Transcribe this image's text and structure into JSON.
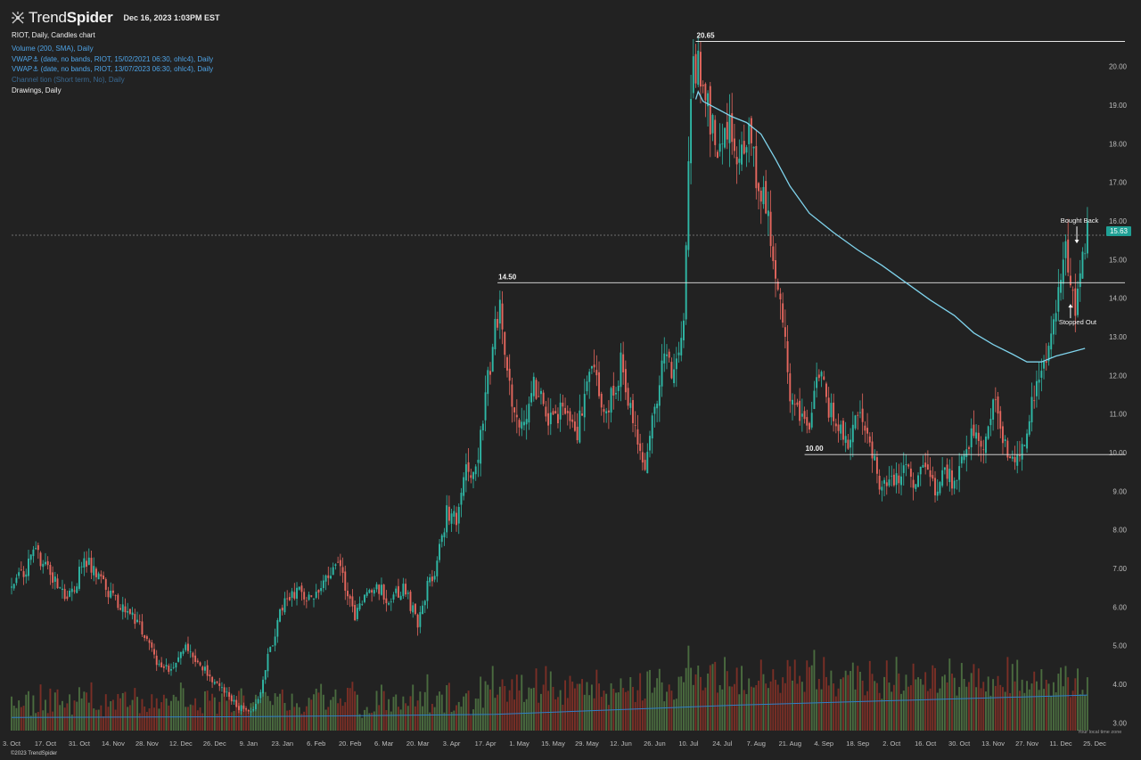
{
  "header": {
    "brand_light": "Trend",
    "brand_bold": "Spider",
    "datetime": "Dec 16, 2023 1:03PM EST"
  },
  "legend": {
    "title": "RIOT, Daily, Candles chart",
    "indicators": [
      "Volume (200, SMA), Daily",
      "VWAP⚓ (date, no bands, RIOT, 15/02/2021 06:30, ohlc4), Daily",
      "VWAP⚓ (date, no bands, RIOT, 13/07/2023 06:30, ohlc4), Daily",
      "Channel tion (Short term, No), Daily"
    ],
    "drawings": "Drawings, Daily"
  },
  "footer": {
    "copyright": "©2023 TrendSpider",
    "timezone": "Your local time zone"
  },
  "colors": {
    "background": "#222222",
    "up": "#2fb8a6",
    "down": "#e5675e",
    "vol_up": "#4a6b3f",
    "vol_down": "#7a2f26",
    "vwap": "#7fd3ec",
    "vol_sma": "#2f7fc8",
    "last_price_tag": "#1fa095"
  },
  "chart_data": {
    "type": "candlestick",
    "symbol": "RIOT",
    "timeframe": "Daily",
    "y_axis": {
      "range": [
        2.8,
        20.8
      ],
      "ticks": [
        "3.00",
        "4.00",
        "5.00",
        "6.00",
        "7.00",
        "8.00",
        "9.00",
        "10.00",
        "11.00",
        "12.00",
        "13.00",
        "14.00",
        "15.00",
        "16.00",
        "17.00",
        "18.00",
        "19.00",
        "20.00"
      ]
    },
    "x_axis": {
      "ticks": [
        "3. Oct",
        "17. Oct",
        "31. Oct",
        "14. Nov",
        "28. Nov",
        "12. Dec",
        "26. Dec",
        "9. Jan",
        "23. Jan",
        "6. Feb",
        "20. Feb",
        "6. Mar",
        "20. Mar",
        "3. Apr",
        "17. Apr",
        "1. May",
        "15. May",
        "29. May",
        "12. Jun",
        "26. Jun",
        "10. Jul",
        "24. Jul",
        "7. Aug",
        "21. Aug",
        "4. Sep",
        "18. Sep",
        "2. Oct",
        "16. Oct",
        "30. Oct",
        "13. Nov",
        "27. Nov",
        "11. Dec",
        "25. Dec"
      ],
      "range_days": [
        0,
        455
      ]
    },
    "last_price": "15.63",
    "close_path": [
      [
        0,
        6.5
      ],
      [
        10,
        7.4
      ],
      [
        16,
        6.9
      ],
      [
        22,
        6.2
      ],
      [
        26,
        6.5
      ],
      [
        30,
        7.3
      ],
      [
        34,
        7.0
      ],
      [
        42,
        6.2
      ],
      [
        52,
        5.6
      ],
      [
        60,
        4.6
      ],
      [
        66,
        4.4
      ],
      [
        72,
        4.9
      ],
      [
        78,
        4.5
      ],
      [
        86,
        3.9
      ],
      [
        94,
        3.4
      ],
      [
        98,
        3.3
      ],
      [
        102,
        3.6
      ],
      [
        106,
        4.7
      ],
      [
        112,
        6.0
      ],
      [
        118,
        6.4
      ],
      [
        124,
        6.3
      ],
      [
        130,
        6.7
      ],
      [
        134,
        7.3
      ],
      [
        138,
        6.6
      ],
      [
        142,
        5.8
      ],
      [
        146,
        6.3
      ],
      [
        150,
        6.6
      ],
      [
        156,
        6.2
      ],
      [
        162,
        6.5
      ],
      [
        168,
        5.6
      ],
      [
        172,
        6.5
      ],
      [
        176,
        7.1
      ],
      [
        180,
        8.5
      ],
      [
        184,
        8.3
      ],
      [
        188,
        9.6
      ],
      [
        192,
        9.4
      ],
      [
        196,
        11.5
      ],
      [
        200,
        13.2
      ],
      [
        202,
        13.6
      ],
      [
        206,
        11.8
      ],
      [
        210,
        10.5
      ],
      [
        216,
        11.8
      ],
      [
        222,
        10.8
      ],
      [
        228,
        11.2
      ],
      [
        234,
        10.6
      ],
      [
        240,
        12.2
      ],
      [
        246,
        10.9
      ],
      [
        252,
        12.3
      ],
      [
        258,
        10.5
      ],
      [
        262,
        9.8
      ],
      [
        266,
        11.2
      ],
      [
        270,
        12.6
      ],
      [
        274,
        12.0
      ],
      [
        278,
        13.4
      ],
      [
        280,
        18.0
      ],
      [
        282,
        19.8
      ],
      [
        284,
        20.1
      ],
      [
        288,
        18.8
      ],
      [
        292,
        17.8
      ],
      [
        296,
        18.5
      ],
      [
        300,
        17.7
      ],
      [
        304,
        18.4
      ],
      [
        308,
        17.2
      ],
      [
        312,
        16.4
      ],
      [
        316,
        14.6
      ],
      [
        320,
        13.0
      ],
      [
        322,
        11.4
      ],
      [
        326,
        11.0
      ],
      [
        330,
        10.5
      ],
      [
        334,
        12.1
      ],
      [
        338,
        11.2
      ],
      [
        342,
        10.8
      ],
      [
        346,
        10.3
      ],
      [
        350,
        11.0
      ],
      [
        354,
        10.6
      ],
      [
        358,
        9.4
      ],
      [
        362,
        9.0
      ],
      [
        366,
        9.3
      ],
      [
        370,
        9.8
      ],
      [
        374,
        9.2
      ],
      [
        378,
        9.9
      ],
      [
        382,
        9.0
      ],
      [
        386,
        9.6
      ],
      [
        390,
        9.1
      ],
      [
        394,
        10.0
      ],
      [
        398,
        10.6
      ],
      [
        402,
        10.1
      ],
      [
        406,
        11.5
      ],
      [
        410,
        10.2
      ],
      [
        414,
        9.7
      ],
      [
        418,
        10.1
      ],
      [
        422,
        11.4
      ],
      [
        426,
        12.2
      ],
      [
        430,
        13.1
      ],
      [
        434,
        14.8
      ],
      [
        436,
        15.3
      ],
      [
        438,
        14.3
      ],
      [
        440,
        13.9
      ],
      [
        442,
        14.6
      ],
      [
        444,
        15.5
      ],
      [
        445,
        15.63
      ]
    ],
    "lines": [
      {
        "label": "20.65",
        "value": 20.65,
        "from_day": 283
      },
      {
        "label": "14.50",
        "value": 14.4,
        "from_day": 201
      },
      {
        "label": "10.00",
        "value": 9.95,
        "from_day": 328
      }
    ],
    "vwap_anchored": [
      [
        283,
        19.15
      ],
      [
        284,
        19.35
      ],
      [
        286,
        19.1
      ],
      [
        292,
        18.9
      ],
      [
        298,
        18.7
      ],
      [
        304,
        18.55
      ],
      [
        310,
        18.25
      ],
      [
        316,
        17.6
      ],
      [
        322,
        16.9
      ],
      [
        330,
        16.2
      ],
      [
        340,
        15.7
      ],
      [
        350,
        15.25
      ],
      [
        360,
        14.85
      ],
      [
        370,
        14.4
      ],
      [
        380,
        13.95
      ],
      [
        390,
        13.55
      ],
      [
        398,
        13.1
      ],
      [
        406,
        12.8
      ],
      [
        414,
        12.55
      ],
      [
        420,
        12.35
      ],
      [
        426,
        12.35
      ],
      [
        432,
        12.5
      ],
      [
        438,
        12.6
      ],
      [
        444,
        12.7
      ]
    ],
    "volume_sma": [
      [
        0,
        3.14
      ],
      [
        100,
        3.16
      ],
      [
        200,
        3.22
      ],
      [
        300,
        3.46
      ],
      [
        400,
        3.64
      ],
      [
        445,
        3.72
      ]
    ],
    "annotations": [
      {
        "text": "Bought Back",
        "day": 441,
        "value": 15.72
      },
      {
        "text": "Stopped Out",
        "day": 438,
        "value": 13.55
      }
    ]
  }
}
